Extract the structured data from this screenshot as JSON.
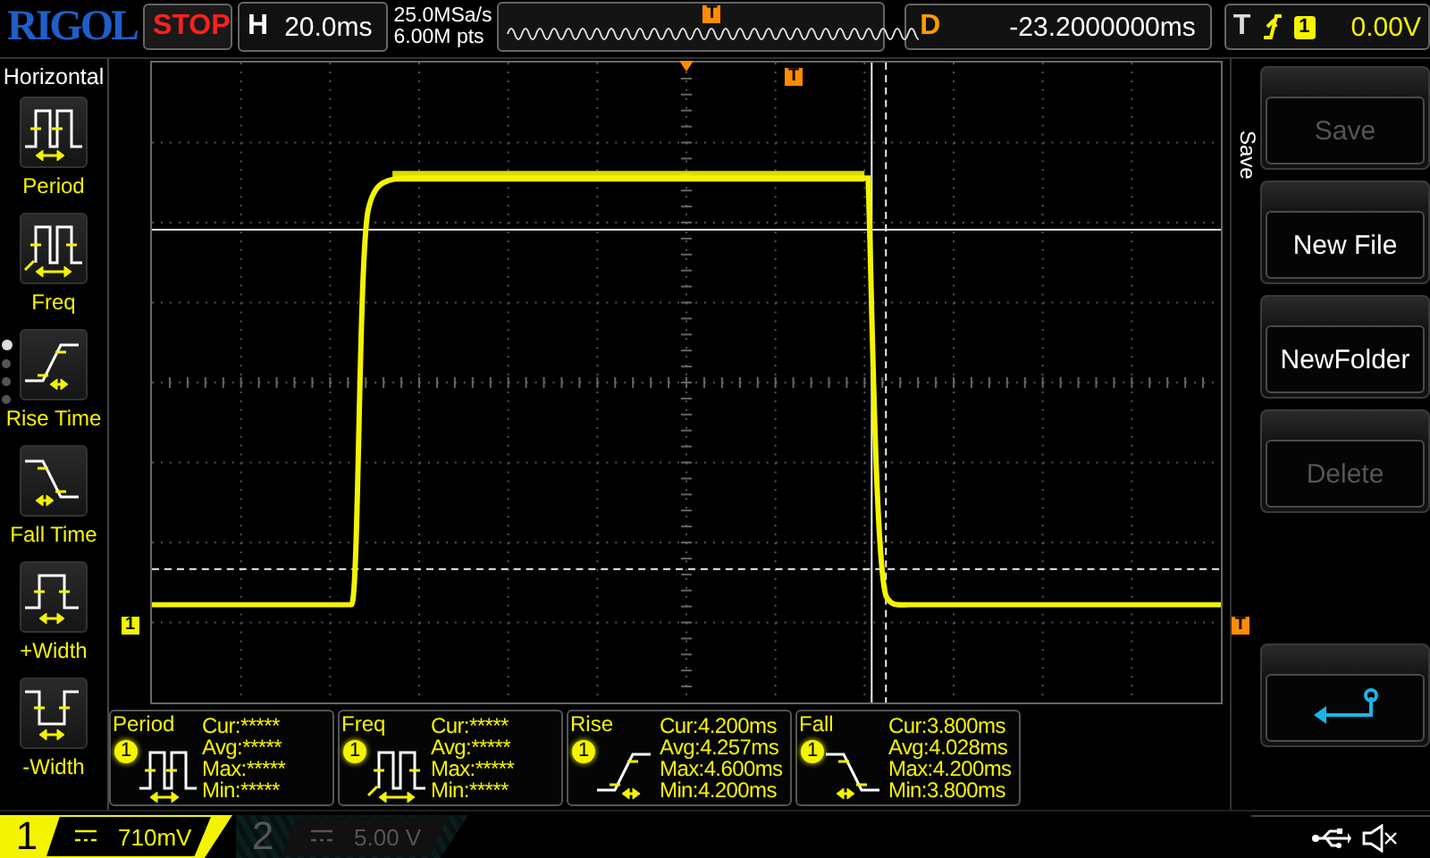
{
  "brand": "RIGOL",
  "run_state": "STOP",
  "horizontal": {
    "label": "H",
    "timebase": "20.0ms",
    "sample_rate": "25.0MSa/s",
    "memory_depth": "6.00M pts",
    "marker": "T"
  },
  "delay": {
    "label": "D",
    "value": "-23.2000000ms"
  },
  "trigger": {
    "label": "T",
    "channel": "1",
    "level": "0.00V"
  },
  "sidebar": {
    "title": "Horizontal",
    "items": [
      {
        "label": "Period",
        "kind": "period"
      },
      {
        "label": "Freq",
        "kind": "freq"
      },
      {
        "label": "Rise Time",
        "kind": "rise"
      },
      {
        "label": "Fall Time",
        "kind": "fall"
      },
      {
        "label": "+Width",
        "kind": "pwidth"
      },
      {
        "label": "-Width",
        "kind": "nwidth"
      }
    ],
    "pages": [
      {
        "selected": true
      },
      {
        "selected": false
      },
      {
        "selected": false
      },
      {
        "selected": false
      }
    ]
  },
  "screen": {
    "channel_marker": "1",
    "trigger_marker": "T",
    "trigger_top_marker": "T"
  },
  "softkeys": {
    "title": "Save",
    "buttons": [
      {
        "kind": "text",
        "label": "Save",
        "disabled": true
      },
      {
        "kind": "text",
        "label": "New File",
        "disabled": false
      },
      {
        "kind": "text",
        "label": "NewFolder",
        "disabled": false
      },
      {
        "kind": "text",
        "label": "Delete",
        "disabled": true
      },
      {
        "kind": "return"
      }
    ]
  },
  "measurements": [
    {
      "name": "Period",
      "channel": "1",
      "kind": "period",
      "rows": [
        {
          "label": "Cur:",
          "value": "*****"
        },
        {
          "label": "Avg:",
          "value": "*****"
        },
        {
          "label": "Max:",
          "value": "*****"
        },
        {
          "label": "Min:",
          "value": "*****"
        }
      ]
    },
    {
      "name": "Freq",
      "channel": "1",
      "kind": "freq",
      "rows": [
        {
          "label": "Cur:",
          "value": "*****"
        },
        {
          "label": "Avg:",
          "value": "*****"
        },
        {
          "label": "Max:",
          "value": "*****"
        },
        {
          "label": "Min:",
          "value": "*****"
        }
      ]
    },
    {
      "name": "Rise",
      "channel": "1",
      "kind": "rise",
      "rows": [
        {
          "label": "Cur:",
          "value": "4.200ms"
        },
        {
          "label": "Avg:",
          "value": "4.257ms"
        },
        {
          "label": "Max:",
          "value": "4.600ms"
        },
        {
          "label": "Min:",
          "value": "4.200ms"
        }
      ]
    },
    {
      "name": "Fall",
      "channel": "1",
      "kind": "fall",
      "rows": [
        {
          "label": "Cur:",
          "value": "3.800ms"
        },
        {
          "label": "Avg:",
          "value": "4.028ms"
        },
        {
          "label": "Max:",
          "value": "4.200ms"
        },
        {
          "label": "Min:",
          "value": "3.800ms"
        }
      ]
    }
  ],
  "channels": [
    {
      "number": "1",
      "scale": "710mV",
      "on": true
    },
    {
      "number": "2",
      "scale": "5.00 V",
      "on": false
    }
  ]
}
